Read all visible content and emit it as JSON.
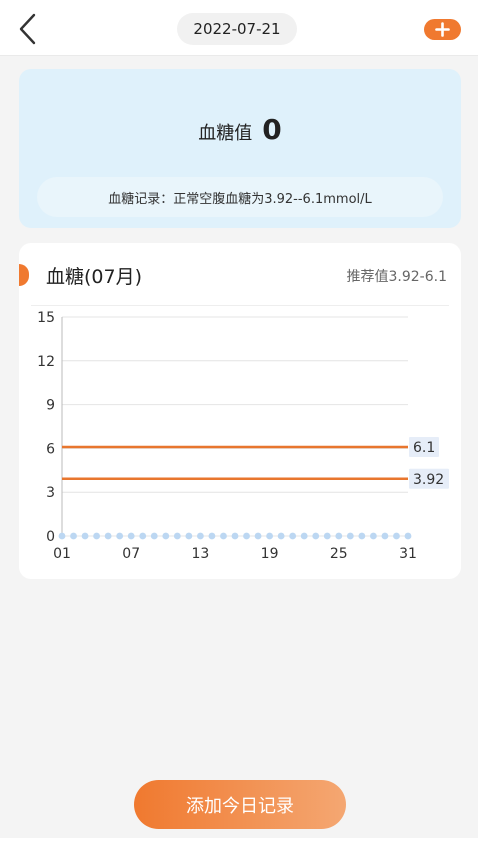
{
  "header": {
    "date": "2022-07-21",
    "back_icon": "chevron-left-icon",
    "add_icon": "plus-icon",
    "add_color": "#f0792f"
  },
  "summary": {
    "label": "血糖值",
    "value": "0",
    "record_text": "血糖记录：正常空腹血糖为3.92--6.1mmol/L"
  },
  "chart_card": {
    "title": "血糖(07月)",
    "recommend": "推荐值3.92-6.1"
  },
  "chart_data": {
    "type": "line",
    "x_ticks": [
      "01",
      "07",
      "13",
      "19",
      "25",
      "31"
    ],
    "y_ticks": [
      0,
      3,
      6,
      9,
      12,
      15
    ],
    "ylim": [
      0,
      15
    ],
    "xlim": [
      1,
      31
    ],
    "grid": true,
    "series": [
      {
        "values": [
          0,
          0,
          0,
          0,
          0,
          0,
          0,
          0,
          0,
          0,
          0,
          0,
          0,
          0,
          0,
          0,
          0,
          0,
          0,
          0,
          0,
          0,
          0,
          0,
          0,
          0,
          0,
          0,
          0,
          0,
          0
        ],
        "color": "#bcd7f2"
      }
    ],
    "reference_lines": [
      {
        "value": 6.1,
        "label": "6.1",
        "color": "#e8762e"
      },
      {
        "value": 3.92,
        "label": "3.92",
        "color": "#e8762e"
      }
    ]
  },
  "footer": {
    "button_label": "添加今日记录"
  }
}
